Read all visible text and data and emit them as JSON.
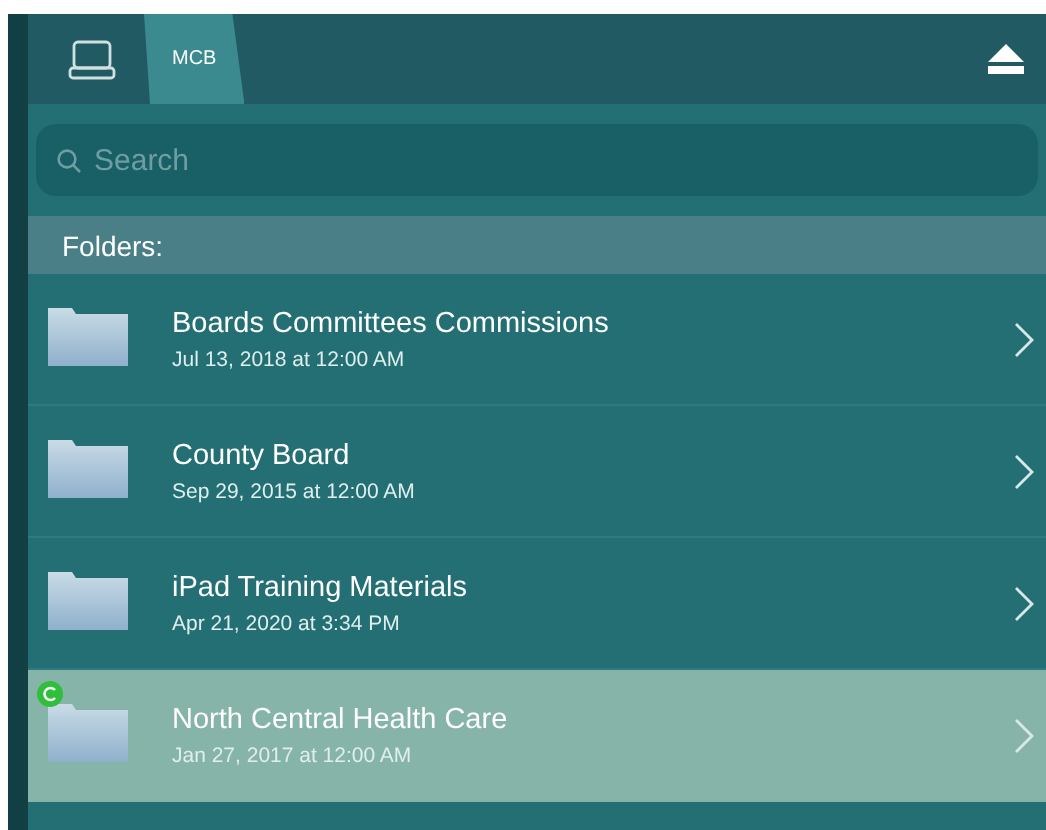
{
  "toolbar": {
    "tabs": [
      {
        "kind": "icon",
        "selected": false
      },
      {
        "kind": "text",
        "label": "MCB",
        "selected": true
      }
    ]
  },
  "search": {
    "placeholder": "Search"
  },
  "section_header": "Folders:",
  "folders": [
    {
      "name": "Boards Committees Commissions",
      "date": "Jul 13, 2018 at 12:00 AM",
      "selected": false,
      "synced": false
    },
    {
      "name": "County Board",
      "date": "Sep 29, 2015 at 12:00 AM",
      "selected": false,
      "synced": false
    },
    {
      "name": "iPad Training Materials",
      "date": "Apr 21, 2020 at 3:34 PM",
      "selected": false,
      "synced": false
    },
    {
      "name": "North Central Health Care",
      "date": "Jan 27, 2017 at 12:00 AM",
      "selected": true,
      "synced": true
    }
  ]
}
